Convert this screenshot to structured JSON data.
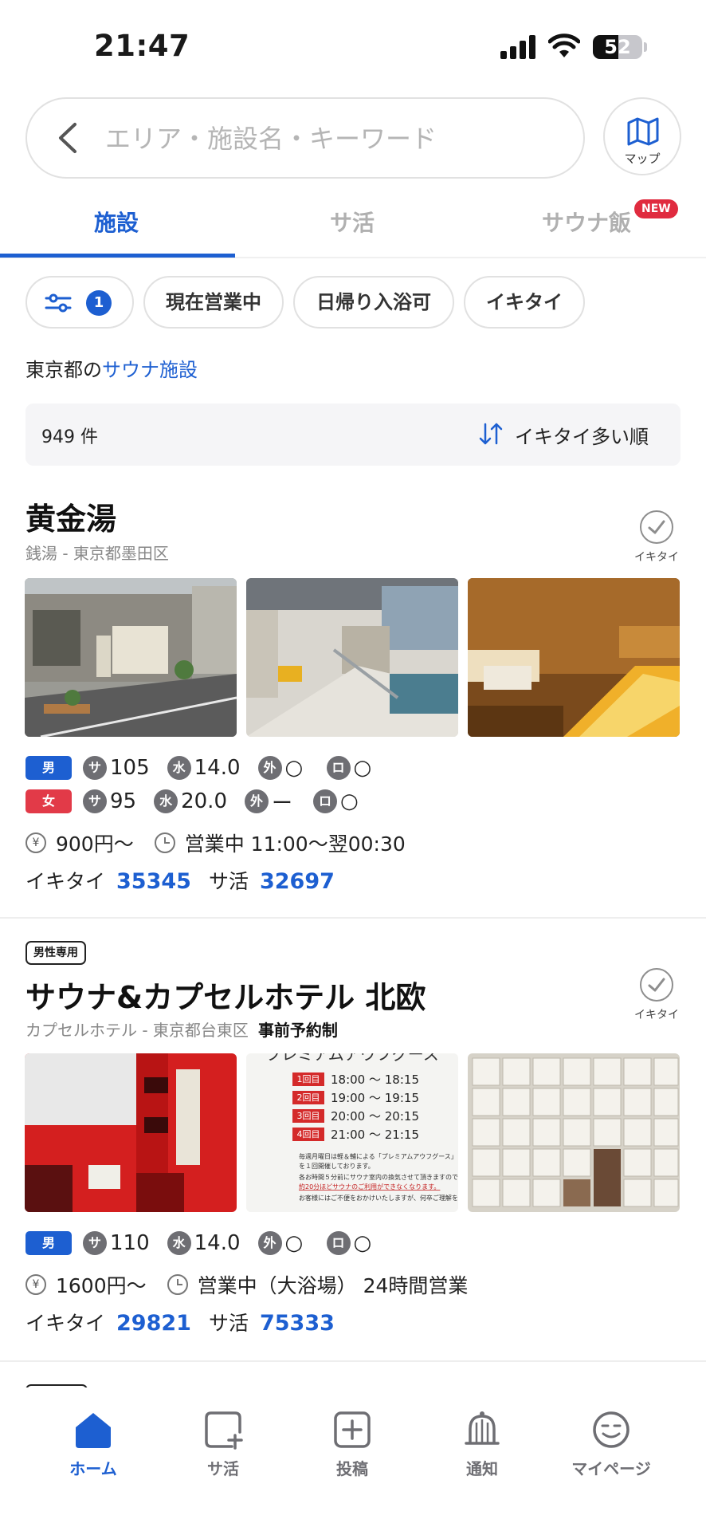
{
  "status_bar": {
    "time": "21:47",
    "battery": "52",
    "battery_level": 0.52
  },
  "search": {
    "placeholder": "エリア・施設名・キーワード",
    "map_label": "マップ"
  },
  "tabs": [
    {
      "label": "施設",
      "active": true
    },
    {
      "label": "サ活",
      "active": false
    },
    {
      "label": "サウナ飯",
      "active": false,
      "badge": "NEW"
    }
  ],
  "filters": {
    "active_count": "1",
    "chips": [
      "現在営業中",
      "日帰り入浴可",
      "イキタイ"
    ]
  },
  "area": {
    "prefix": "東京都の",
    "link": "サウナ施設"
  },
  "results": {
    "count": "949 件",
    "sort_label": "イキタイ多い順"
  },
  "stat_icons": {
    "sauna": "サ",
    "water": "水",
    "outdoor": "外",
    "lounge": "ロ",
    "yen": "¥"
  },
  "facilities": [
    {
      "name": "黄金湯",
      "category_area": "銭湯 - 東京都墨田区",
      "ikitai_button": "イキタイ",
      "genders": [
        {
          "label": "男",
          "sauna": "105",
          "water": "14.0",
          "outdoor": "○",
          "lounge": "○"
        },
        {
          "label": "女",
          "sauna": "95",
          "water": "20.0",
          "outdoor": "ー",
          "lounge": "○"
        }
      ],
      "price": "900円〜",
      "hours": "営業中 11:00〜翌00:30",
      "ikitai_label": "イキタイ",
      "ikitai_count": "35345",
      "sakatsu_label": "サ活",
      "sakatsu_count": "32697"
    },
    {
      "badge": "男性専用",
      "name": "サウナ&カプセルホテル 北欧",
      "category_area": "カプセルホテル - 東京都台東区",
      "reservation": "事前予約制",
      "ikitai_button": "イキタイ",
      "genders": [
        {
          "label": "男",
          "sauna": "110",
          "water": "14.0",
          "outdoor": "○",
          "lounge": "○"
        }
      ],
      "price": "1600円〜",
      "hours": "営業中（大浴場） 24時間営業",
      "ikitai_label": "イキタイ",
      "ikitai_count": "29821",
      "sakatsu_label": "サ活",
      "sakatsu_count": "75333",
      "photo_text": {
        "title": "プレミアムアウフグース",
        "rounds": [
          {
            "no": "1回目",
            "time": "18:00 〜 18:15"
          },
          {
            "no": "2回目",
            "time": "19:00 〜 19:15"
          },
          {
            "no": "3回目",
            "time": "20:00 〜 20:15"
          },
          {
            "no": "4回目",
            "time": "21:00 〜 21:15"
          }
        ],
        "note1": "毎週月曜日は軽＆輔による「プレミアムアウフグース」",
        "note2": "を１回開催しております。",
        "note3": "各お時間５分前にサウナ室内の換気させて頂きますので、",
        "note4": "約20分ほどサウナのご利用ができなくなります。",
        "note5": "お客様にはご不便をおかけいたしますが、何卒ご理解を"
      }
    }
  ],
  "bottom_nav": [
    {
      "label": "ホーム",
      "icon": "home-icon",
      "active": true
    },
    {
      "label": "サ活",
      "icon": "sakatsu-post-icon",
      "active": false
    },
    {
      "label": "投稿",
      "icon": "plus-square-icon",
      "active": false
    },
    {
      "label": "通知",
      "icon": "bell-icon",
      "active": false
    },
    {
      "label": "マイページ",
      "icon": "smiley-icon",
      "active": false
    }
  ],
  "colors": {
    "accent": "#1d5fd1",
    "female": "#e23a48",
    "new_badge": "#e02b3f"
  }
}
